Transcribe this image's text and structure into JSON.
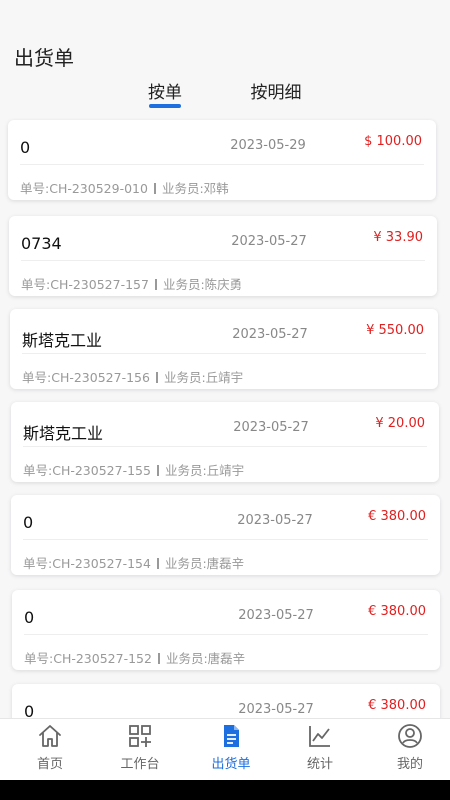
{
  "header": {
    "title": "出货单"
  },
  "tabs": [
    {
      "label": "按单",
      "active": true
    },
    {
      "label": "按明细",
      "active": false
    }
  ],
  "orders": [
    {
      "customer": "0",
      "date": "2023-05-29",
      "amount": "$ 100.00",
      "order_no": "单号:CH-230529-010",
      "salesperson": "业务员:邓韩"
    },
    {
      "customer": "0734",
      "date": "2023-05-27",
      "amount": "¥ 33.90",
      "order_no": "单号:CH-230527-157",
      "salesperson": "业务员:陈庆勇"
    },
    {
      "customer": "斯塔克工业",
      "date": "2023-05-27",
      "amount": "¥ 550.00",
      "order_no": "单号:CH-230527-156",
      "salesperson": "业务员:丘靖宇"
    },
    {
      "customer": "斯塔克工业",
      "date": "2023-05-27",
      "amount": "¥ 20.00",
      "order_no": "单号:CH-230527-155",
      "salesperson": "业务员:丘靖宇"
    },
    {
      "customer": "0",
      "date": "2023-05-27",
      "amount": "€ 380.00",
      "order_no": "单号:CH-230527-154",
      "salesperson": "业务员:唐磊辛"
    },
    {
      "customer": "0",
      "date": "2023-05-27",
      "amount": "€ 380.00",
      "order_no": "单号:CH-230527-152",
      "salesperson": "业务员:唐磊辛"
    },
    {
      "customer": "0",
      "date": "2023-05-27",
      "amount": "€ 380.00",
      "order_no": "",
      "salesperson": ""
    }
  ],
  "bottom_nav": [
    {
      "label": "首页",
      "icon": "home-icon",
      "active": false
    },
    {
      "label": "工作台",
      "icon": "workbench-icon",
      "active": false
    },
    {
      "label": "出货单",
      "icon": "document-icon",
      "active": true
    },
    {
      "label": "统计",
      "icon": "chart-icon",
      "active": false
    },
    {
      "label": "我的",
      "icon": "user-icon",
      "active": false
    }
  ],
  "colors": {
    "accent": "#1d6fe0",
    "amount": "#e02020",
    "background": "#f7f7f8"
  }
}
